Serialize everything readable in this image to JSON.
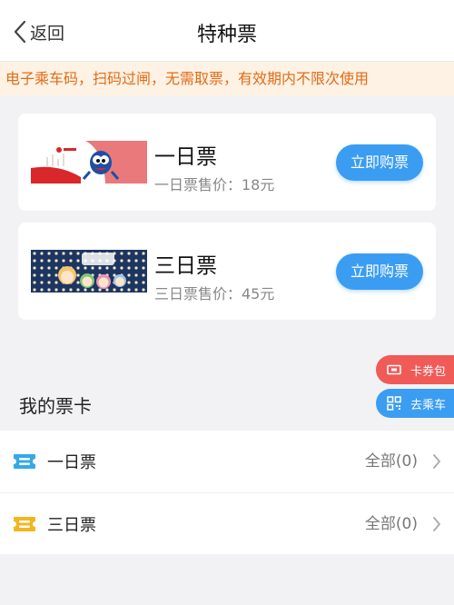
{
  "nav": {
    "back_label": "返回",
    "title": "特种票"
  },
  "notice": "电子乘车码，扫码过闸，无需取票，有效期内不限次使用",
  "tickets": [
    {
      "name": "一日票",
      "price_text": "一日票售价：18元",
      "buy_label": "立即购票",
      "banner_icon": "red-mascot-banner"
    },
    {
      "name": "三日票",
      "price_text": "三日票售价：45元",
      "buy_label": "立即购票",
      "banner_icon": "navy-cartoon-banner"
    }
  ],
  "floating": {
    "wallet_label": "卡券包",
    "ride_label": "去乘车"
  },
  "my_cards": {
    "title": "我的票卡",
    "items": [
      {
        "label": "一日票",
        "count": "全部(0)",
        "icon_color": "#35a9e8"
      },
      {
        "label": "三日票",
        "count": "全部(0)",
        "icon_color": "#f2b620"
      }
    ]
  },
  "colors": {
    "accent": "#3b9df2",
    "notice_text": "#e36b16",
    "notice_bg": "#fdf2e4",
    "wallet_bg": "#f05a57"
  }
}
